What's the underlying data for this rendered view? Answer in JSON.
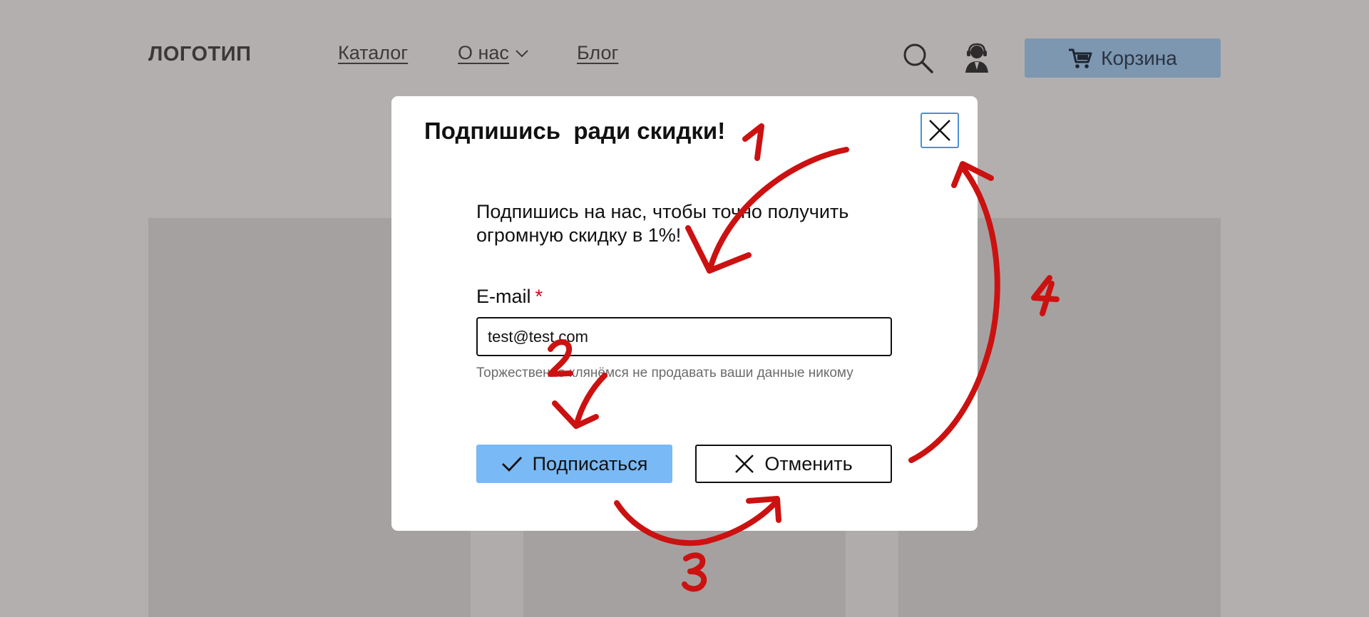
{
  "header": {
    "logo": "ЛОГОТИП",
    "nav": [
      {
        "label": "Каталог"
      },
      {
        "label": "О нас"
      },
      {
        "label": "Блог"
      }
    ],
    "search_icon": "search-icon",
    "support_icon": "support-operator-icon",
    "cart": {
      "label": "Корзина",
      "icon": "cart-icon",
      "color": "#7d97b1"
    }
  },
  "modal": {
    "title": "Подпишись  ради скидки!",
    "lead": "Подпишись на нас, чтобы точно получить огромную скидку в 1%!",
    "email": {
      "label": "E-mail",
      "required_mark": "*",
      "value": "test@test.com"
    },
    "hint": "Торжественно клянёмся не продавать ваши данные никому",
    "subscribe_label": "Подписаться",
    "cancel_label": "Отменить",
    "accent_color": "#79b9f5",
    "focus_color": "#4a90d9"
  },
  "annotations": {
    "color": "#cc1111",
    "steps": [
      "1",
      "2",
      "3",
      "4"
    ]
  }
}
